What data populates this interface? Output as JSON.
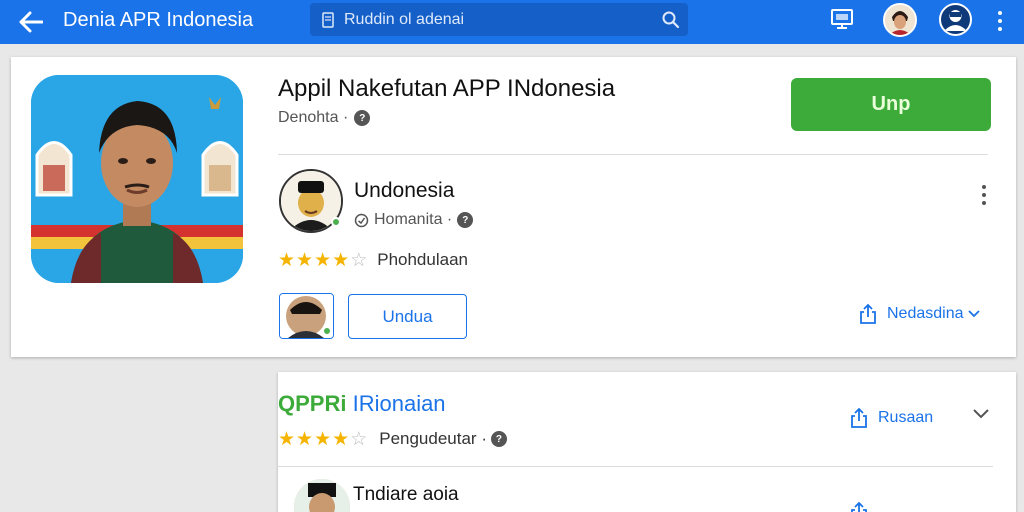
{
  "topbar": {
    "title": "Denia APR Indonesia",
    "search_placeholder": "Ruddin ol adenai",
    "icons": [
      "back-arrow-icon",
      "document-icon",
      "search-icon",
      "monitor-icon",
      "avatar",
      "account-icon",
      "kebab-menu-icon"
    ]
  },
  "app": {
    "title": "Appil Nakefutan APP INdonesia",
    "developer": "Denohta ·",
    "install_label": "Unp"
  },
  "review": {
    "name": "Undonesia",
    "sub": "Homanita ·",
    "stars": 4,
    "max_stars": 5,
    "rating_label": "Phohdulaan",
    "button_label": "Undua",
    "share_label": "Nedasdina"
  },
  "related": {
    "brand": "QPPRi",
    "title_rest": "IRionaian",
    "link_label": "Rusaan",
    "stars": 4,
    "max_stars": 5,
    "rating_label": "Pengudeutar ·",
    "item_title": "Tndiare aoia"
  },
  "colors": {
    "topbar": "#1a73e8",
    "install": "#3cab3a",
    "accent": "#1a73e8",
    "star": "#f4b400"
  }
}
